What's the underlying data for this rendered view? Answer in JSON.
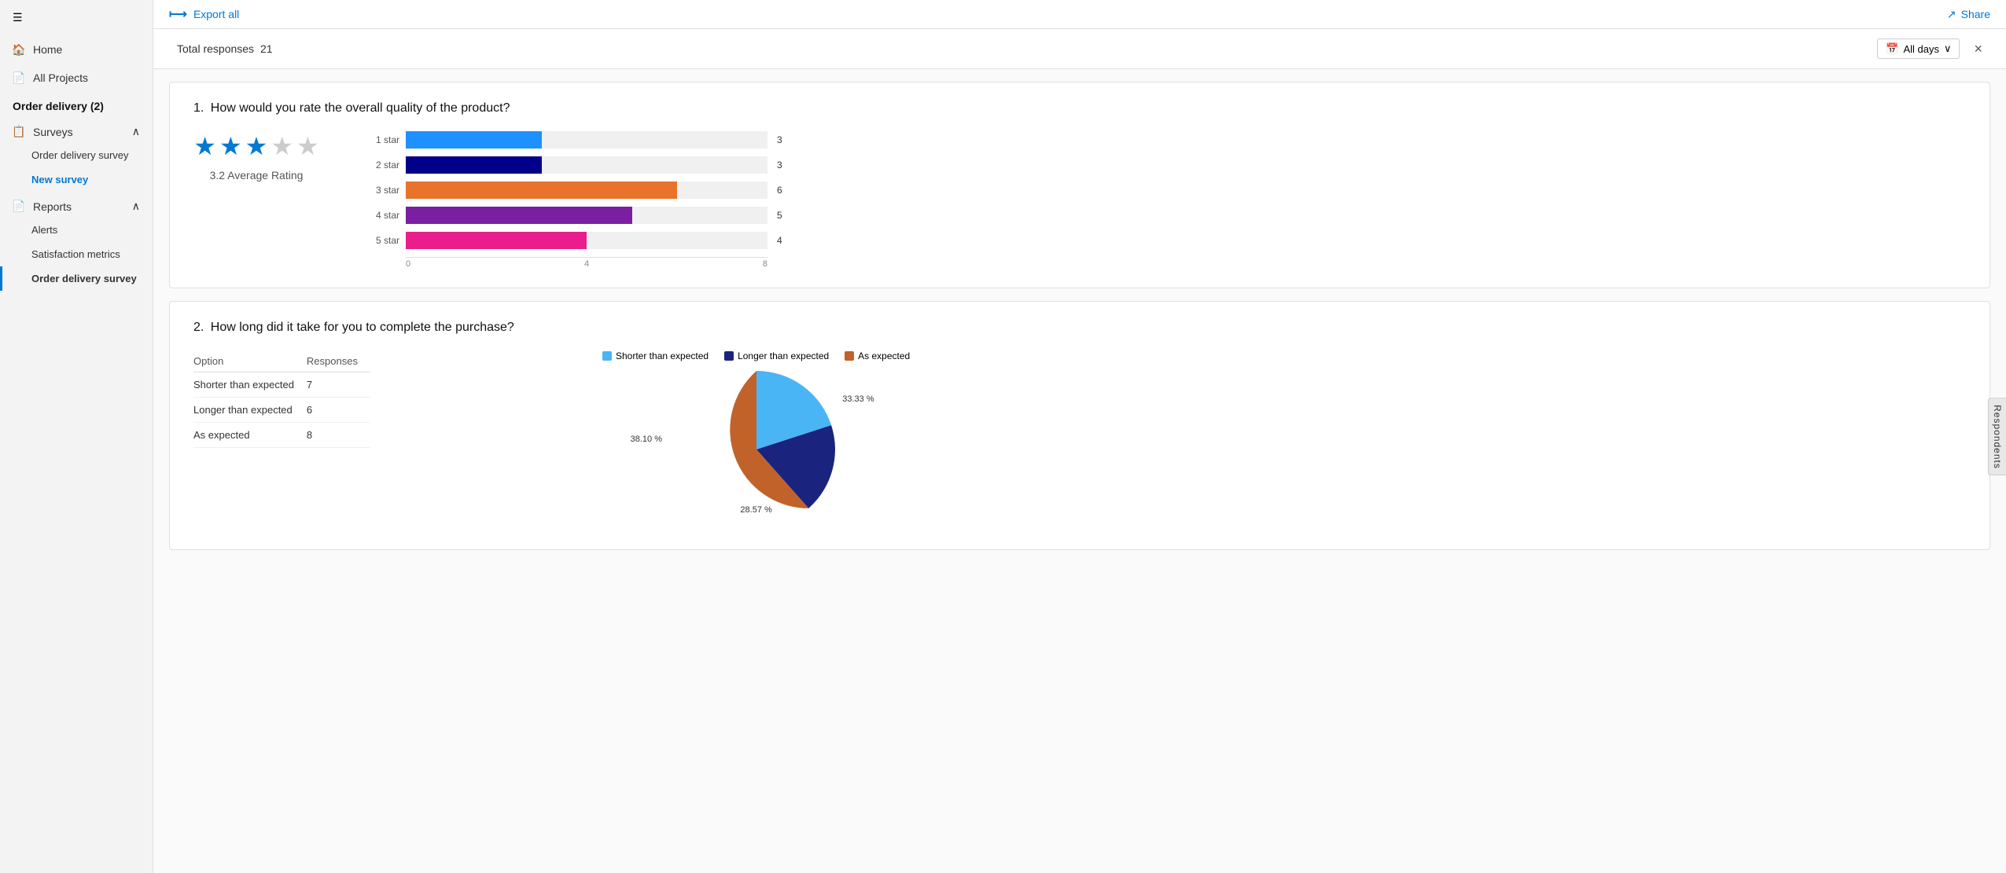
{
  "sidebar": {
    "hamburger_icon": "☰",
    "nav_items": [
      {
        "id": "home",
        "label": "Home",
        "icon": "🏠"
      },
      {
        "id": "all-projects",
        "label": "All Projects",
        "icon": "📄"
      }
    ],
    "section_title": "Order delivery (2)",
    "surveys_label": "Surveys",
    "survey_items": [
      {
        "id": "order-delivery-survey",
        "label": "Order delivery survey",
        "active": false
      },
      {
        "id": "new-survey",
        "label": "New survey",
        "active": true
      }
    ],
    "reports_label": "Reports",
    "report_items": [
      {
        "id": "alerts",
        "label": "Alerts",
        "active": false
      },
      {
        "id": "satisfaction-metrics",
        "label": "Satisfaction metrics",
        "active": false
      },
      {
        "id": "order-delivery-survey-report",
        "label": "Order delivery survey",
        "active": false,
        "selected": true
      }
    ]
  },
  "toolbar": {
    "export_label": "Export all",
    "export_icon": "→",
    "share_label": "Share",
    "share_icon": "↗"
  },
  "content_header": {
    "total_responses_label": "Total responses",
    "total_responses_value": "21",
    "days_filter_label": "All days",
    "collapse_icon": "✕"
  },
  "question1": {
    "number": "1.",
    "text": "How would you rate the overall quality of the product?",
    "average_rating": 3.2,
    "average_label": "3.2 Average Rating",
    "stars_filled": 3,
    "stars_empty": 2,
    "bars": [
      {
        "label": "1 star",
        "value": 3,
        "max": 8,
        "color": "#1e90ff"
      },
      {
        "label": "2 star",
        "value": 3,
        "max": 8,
        "color": "#00008b"
      },
      {
        "label": "3 star",
        "value": 6,
        "max": 8,
        "color": "#e8732a"
      },
      {
        "label": "4 star",
        "value": 5,
        "max": 8,
        "color": "#7b1fa2"
      },
      {
        "label": "5 star",
        "value": 4,
        "max": 8,
        "color": "#e91e8c"
      }
    ],
    "axis_labels": [
      "0",
      "4",
      "8"
    ]
  },
  "question2": {
    "number": "2.",
    "text": "How long did it take for you to complete the purchase?",
    "table_headers": [
      "Option",
      "Responses"
    ],
    "table_rows": [
      {
        "option": "Shorter than expected",
        "responses": "7"
      },
      {
        "option": "Longer than expected",
        "responses": "6"
      },
      {
        "option": "As expected",
        "responses": "8"
      }
    ],
    "pie": {
      "slices": [
        {
          "label": "Shorter than expected",
          "value": 7,
          "percent": 33.33,
          "percent_label": "33.33 %",
          "color": "#4ab5f5"
        },
        {
          "label": "Longer than expected",
          "value": 6,
          "percent": 28.57,
          "percent_label": "28.57 %",
          "color": "#1a237e"
        },
        {
          "label": "As expected",
          "value": 8,
          "percent": 38.1,
          "percent_label": "38.10 %",
          "color": "#c0622a"
        }
      ]
    }
  },
  "respondents_tab": "Respondents"
}
